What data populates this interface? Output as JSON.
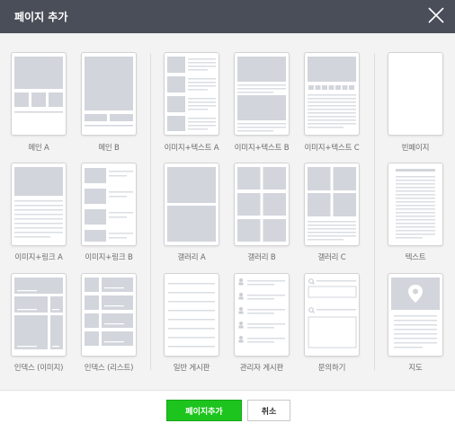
{
  "dialog": {
    "title": "페이지 추가"
  },
  "templates": {
    "main_a": "메인 A",
    "main_b": "메인 B",
    "image_text_a": "이미지+텍스트 A",
    "image_text_b": "이미지+텍스트 B",
    "image_text_c": "이미지+텍스트 C",
    "blank_page": "빈페이지",
    "image_link_a": "이미지+링크 A",
    "image_link_b": "이미지+링크 B",
    "gallery_a": "갤러리 A",
    "gallery_b": "갤러리 B",
    "gallery_c": "갤러리 C",
    "text": "텍스트",
    "index_image": "인덱스 (이미지)",
    "index_list": "인덱스 (리스트)",
    "general_board": "일반 게시판",
    "admin_board": "관리자 게시판",
    "inquiry": "문의하기",
    "map": "지도"
  },
  "footer": {
    "add_label": "페이지추가",
    "cancel_label": "취소"
  },
  "colors": {
    "titlebar": "#4a4e59",
    "accent": "#1ec41e",
    "placeholder": "#d2d5db"
  },
  "icons": {
    "close": "close-icon",
    "map_pin": "map-pin-icon",
    "search": "search-icon",
    "person": "person-icon"
  }
}
